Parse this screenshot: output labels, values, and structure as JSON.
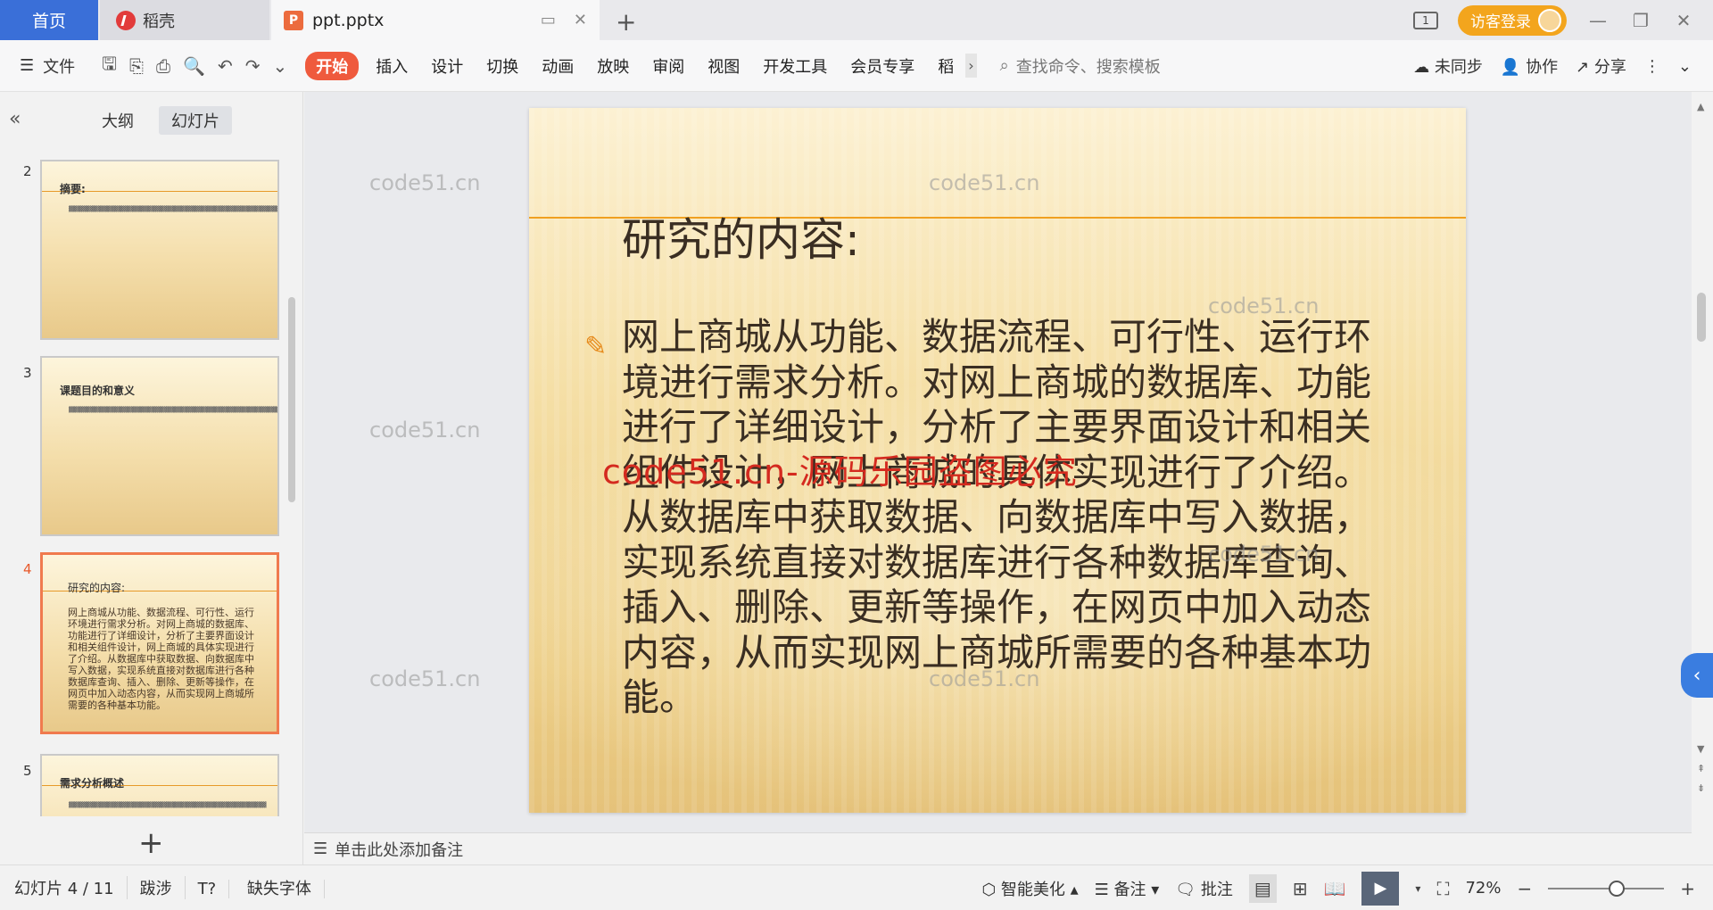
{
  "titlebar": {
    "home_tab": "首页",
    "app_tab": "稻壳",
    "doc_tab": "ppt.pptx",
    "page_badge": "1",
    "login_label": "访客登录"
  },
  "ribbon": {
    "file_label": "文件",
    "menu": [
      "开始",
      "插入",
      "设计",
      "切换",
      "动画",
      "放映",
      "审阅",
      "视图",
      "开发工具",
      "会员专享",
      "稻"
    ],
    "search_placeholder": "查找命令、搜索模板",
    "sync_label": "未同步",
    "collab_label": "协作",
    "share_label": "分享"
  },
  "left_panel": {
    "tabs": [
      "大纲",
      "幻灯片"
    ],
    "active_tab": "幻灯片",
    "thumbnails": [
      {
        "num": "2",
        "title": "摘要:"
      },
      {
        "num": "3",
        "title": "课题目的和意义"
      },
      {
        "num": "4",
        "title": "研究的内容:",
        "body": "网上商城从功能、数据流程、可行性、运行环境进行需求分析。对网上商城的数据库、功能进行了详细设计，分析了主要界面设计和相关组件设计，网上商城的具体实现进行了介绍。从数据库中获取数据、向数据库中写入数据，实现系统直接对数据库进行各种数据库查询、插入、删除、更新等操作，在网页中加入动态内容，从而实现网上商城所需要的各种基本功能。"
      },
      {
        "num": "5",
        "title": "需求分析概述"
      }
    ]
  },
  "slide": {
    "title": "研究的内容:",
    "body": "网上商城从功能、数据流程、可行性、运行环境进行需求分析。对网上商城的数据库、功能进行了详细设计，分析了主要界面设计和相关组件设计，网上商城的具体实现进行了介绍。从数据库中获取数据、向数据库中写入数据，实现系统直接对数据库进行各种数据库查询、插入、删除、更新等操作，在网页中加入动态内容，从而实现网上商城所需要的各种基本功能。",
    "overlay_text": "code51.cn-源码乐园盗图必究",
    "watermark": "code51.cn"
  },
  "notes_placeholder": "单击此处添加备注",
  "status": {
    "slide_counter": "幻灯片 4 / 11",
    "theme": "跋涉",
    "missing_font": "缺失字体",
    "beautify": "智能美化",
    "notes": "备注",
    "comments": "批注",
    "zoom": "72%"
  },
  "colors": {
    "accent_tab": "#3a6fd8",
    "active_menu": "#ef5a3d",
    "login": "#f3a51d",
    "slide_line": "#f0a020",
    "overlay_red": "#d42a1f"
  }
}
